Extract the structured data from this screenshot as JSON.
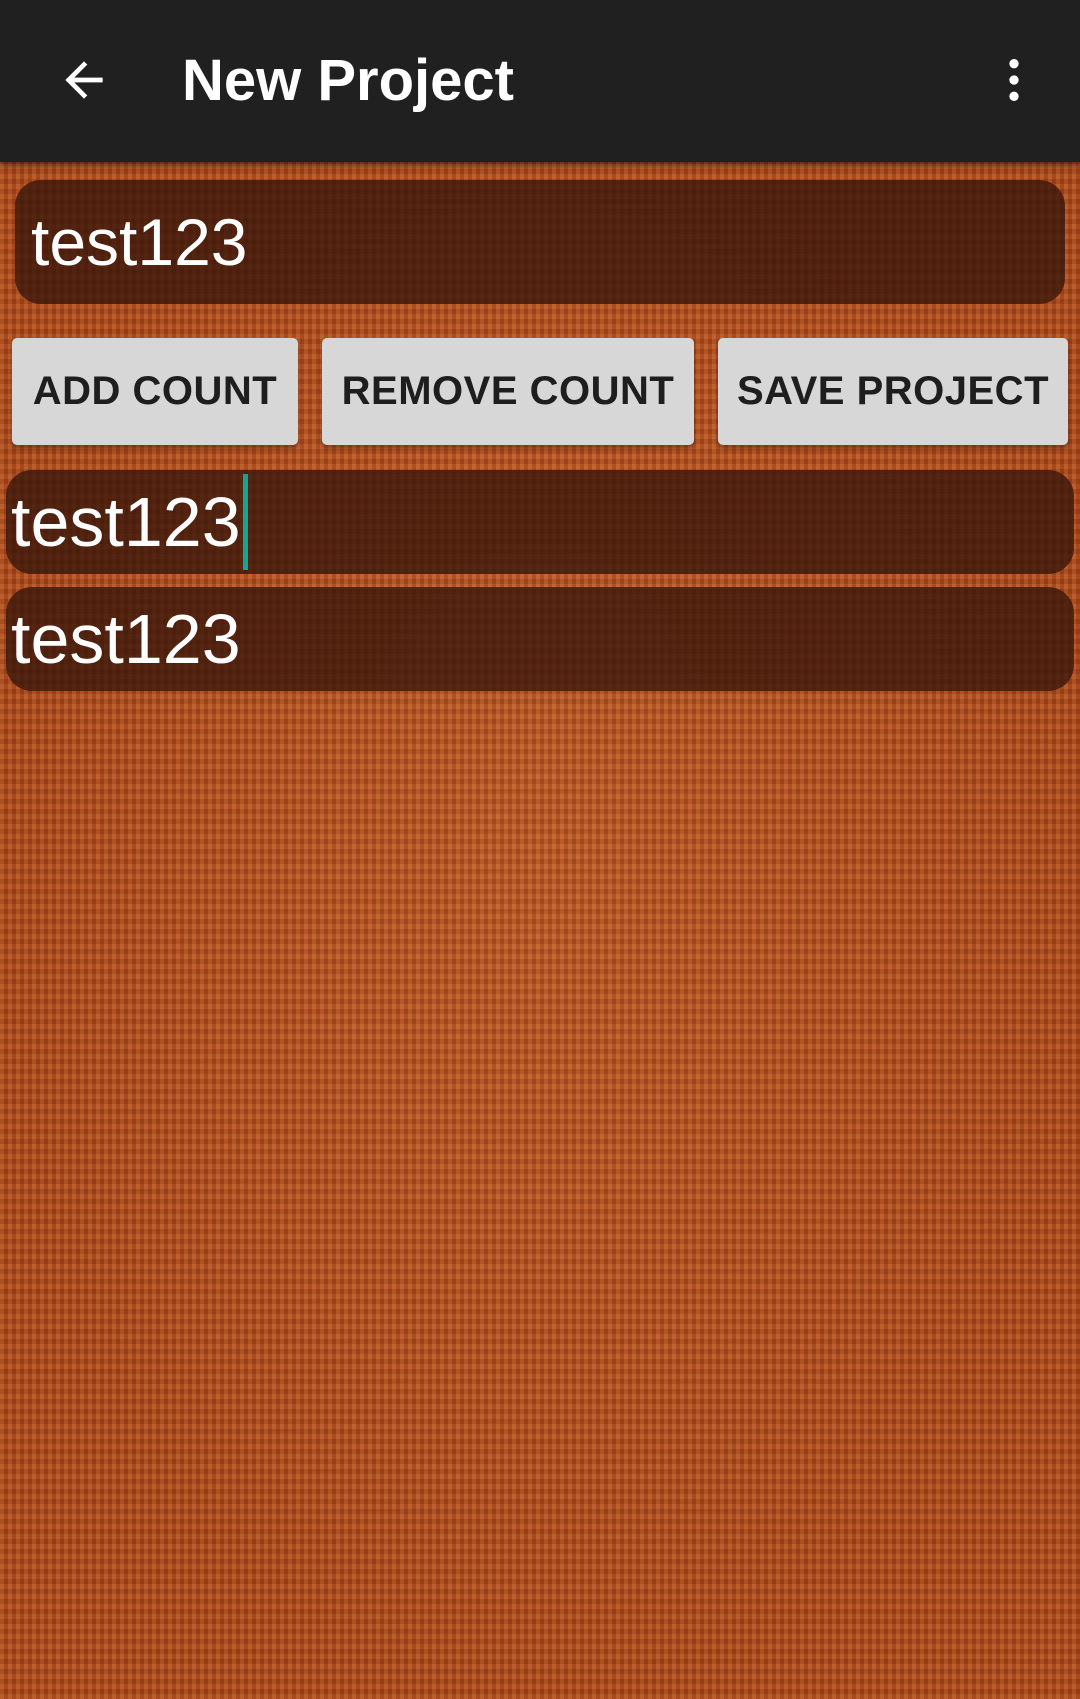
{
  "app_bar": {
    "title": "New Project",
    "back_icon": "arrow-left-icon",
    "menu_icon": "more-vert-icon",
    "background": "#202020"
  },
  "project_name_field": {
    "value": "test123"
  },
  "buttons": {
    "add_count": "ADD COUNT",
    "remove_count": "REMOVE COUNT",
    "save_project": "SAVE PROJECT"
  },
  "counter_fields": [
    {
      "value": "test123",
      "focused": true
    },
    {
      "value": "test123",
      "focused": false
    }
  ],
  "colors": {
    "background_knit": "#b4501f",
    "field_fill": "#37160a",
    "button_fill": "#d7d7d7",
    "caret": "#10a894"
  }
}
